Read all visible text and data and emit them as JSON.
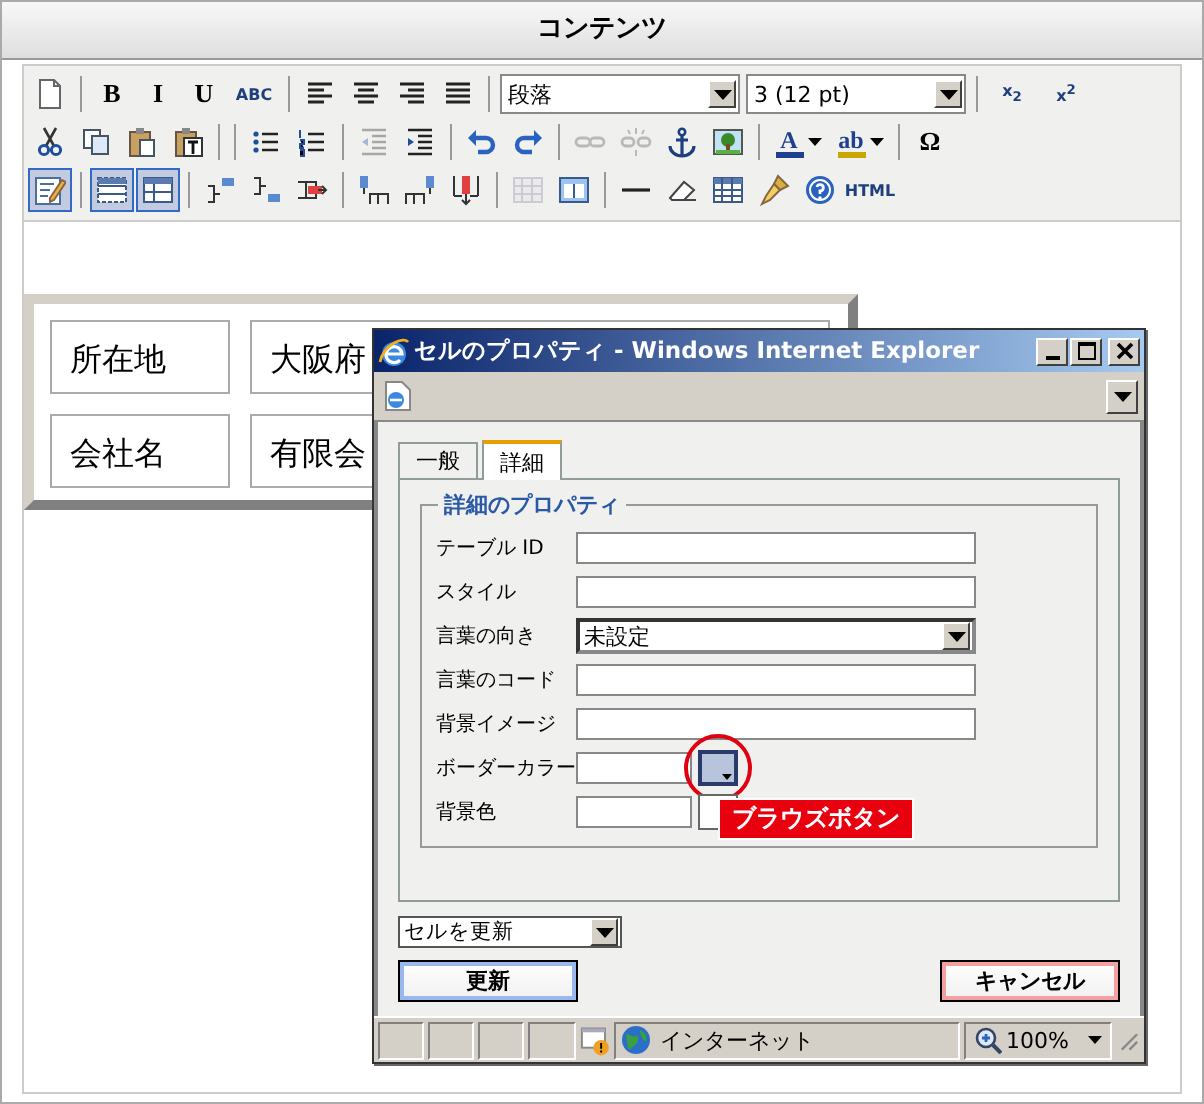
{
  "page_title": "コンテンツ",
  "toolbar_rows": [
    [
      {
        "kind": "button",
        "pressed": false,
        "disabled": false
      },
      {
        "kind": "separator"
      },
      {
        "kind": "button",
        "label": "B",
        "pressed": false,
        "disabled": false
      },
      {
        "kind": "button",
        "label": "I",
        "pressed": false,
        "disabled": false
      },
      {
        "kind": "button",
        "label": "U",
        "pressed": false,
        "disabled": false
      },
      {
        "kind": "button",
        "label": "ABC",
        "pressed": false,
        "disabled": false
      },
      {
        "kind": "separator"
      },
      {
        "kind": "button",
        "pressed": false,
        "disabled": false
      },
      {
        "kind": "button",
        "pressed": false,
        "disabled": false
      },
      {
        "kind": "button",
        "pressed": false,
        "disabled": false
      },
      {
        "kind": "button",
        "pressed": false,
        "disabled": false
      },
      {
        "kind": "separator"
      },
      {
        "kind": "select",
        "value": "段落"
      },
      {
        "kind": "select",
        "value": "3 (12 pt)"
      },
      {
        "kind": "separator"
      },
      {
        "kind": "button",
        "label": "x$_{2}$",
        "pressed": false,
        "disabled": false
      },
      {
        "kind": "button",
        "label": "x$^{2}$",
        "pressed": false,
        "disabled": false
      }
    ],
    [
      {
        "kind": "button",
        "pressed": false,
        "disabled": false
      },
      {
        "kind": "button",
        "pressed": false,
        "disabled": false
      },
      {
        "kind": "button",
        "pressed": false,
        "disabled": false
      },
      {
        "kind": "button",
        "pressed": false,
        "disabled": false
      },
      {
        "kind": "separator"
      },
      {
        "kind": "separator"
      },
      {
        "kind": "button",
        "pressed": false,
        "disabled": false
      },
      {
        "kind": "button",
        "pressed": false,
        "disabled": false
      },
      {
        "kind": "separator"
      },
      {
        "kind": "button",
        "pressed": false,
        "disabled": true
      },
      {
        "kind": "button",
        "pressed": false,
        "disabled": false
      },
      {
        "kind": "separator"
      },
      {
        "kind": "button",
        "pressed": false,
        "disabled": false
      },
      {
        "kind": "button",
        "pressed": false,
        "disabled": false
      },
      {
        "kind": "separator"
      },
      {
        "kind": "button",
        "pressed": false,
        "disabled": true
      },
      {
        "kind": "button",
        "pressed": false,
        "disabled": true
      },
      {
        "kind": "button",
        "pressed": false,
        "disabled": false
      },
      {
        "kind": "button",
        "pressed": false,
        "disabled": false
      },
      {
        "kind": "separator"
      },
      {
        "kind": "color-button",
        "label": "A",
        "color": "#1f3f8f",
        "pressed": false,
        "disabled": false
      },
      {
        "kind": "color-button",
        "label": "ab",
        "color": "#c8a800",
        "pressed": false,
        "disabled": false
      },
      {
        "kind": "separator"
      },
      {
        "kind": "button",
        "label": "Ω",
        "pressed": false,
        "disabled": false
      }
    ],
    [
      {
        "kind": "button",
        "pressed": true,
        "disabled": false
      },
      {
        "kind": "separator"
      },
      {
        "kind": "button",
        "pressed": true,
        "disabled": false
      },
      {
        "kind": "button",
        "pressed": true,
        "disabled": false
      },
      {
        "kind": "separator"
      },
      {
        "kind": "button",
        "pressed": false,
        "disabled": false
      },
      {
        "kind": "button",
        "pressed": false,
        "disabled": false
      },
      {
        "kind": "button",
        "pressed": false,
        "disabled": false
      },
      {
        "kind": "separator"
      },
      {
        "kind": "button",
        "pressed": false,
        "disabled": false
      },
      {
        "kind": "button",
        "pressed": false,
        "disabled": false
      },
      {
        "kind": "button",
        "pressed": false,
        "disabled": false
      },
      {
        "kind": "separator"
      },
      {
        "kind": "button",
        "pressed": false,
        "disabled": true
      },
      {
        "kind": "button",
        "pressed": false,
        "disabled": false
      },
      {
        "kind": "separator"
      },
      {
        "kind": "button",
        "pressed": false,
        "disabled": false
      },
      {
        "kind": "button",
        "pressed": false,
        "disabled": false
      },
      {
        "kind": "button",
        "pressed": false,
        "disabled": false
      },
      {
        "kind": "button",
        "pressed": false,
        "disabled": false
      },
      {
        "kind": "button",
        "pressed": false,
        "disabled": false
      },
      {
        "kind": "button",
        "label": "HTML",
        "pressed": false,
        "disabled": false
      }
    ]
  ],
  "table": {
    "rows": [
      [
        "所在地",
        "大阪府"
      ],
      [
        "会社名",
        "有限会"
      ]
    ]
  },
  "dialog": {
    "title": "セルのプロパティ - Windows Internet Explorer",
    "tabs": [
      {
        "label": "一般",
        "selected": false
      },
      {
        "label": "詳細",
        "selected": true
      }
    ],
    "group_title": "詳細のプロパティ",
    "fields": [
      {
        "kind": "text",
        "label": "テーブル ID"
      },
      {
        "kind": "text",
        "label": "スタイル"
      },
      {
        "kind": "select",
        "label": "言葉の向き",
        "value": "未設定"
      },
      {
        "kind": "text",
        "label": "言葉のコード"
      },
      {
        "kind": "text",
        "label": "背景イメージ"
      },
      {
        "kind": "color",
        "label": "ボーダーカラー",
        "highlighted": true
      },
      {
        "kind": "color",
        "label": "背景色",
        "highlighted": false
      }
    ],
    "callout": "ブラウズボタン",
    "scope_select": "セルを更新",
    "buttons": [
      {
        "kind": "primary",
        "label": "更新"
      },
      {
        "kind": "cancel",
        "label": "キャンセル"
      }
    ],
    "status": {
      "zone": "インターネット",
      "zoom": "100%"
    }
  }
}
